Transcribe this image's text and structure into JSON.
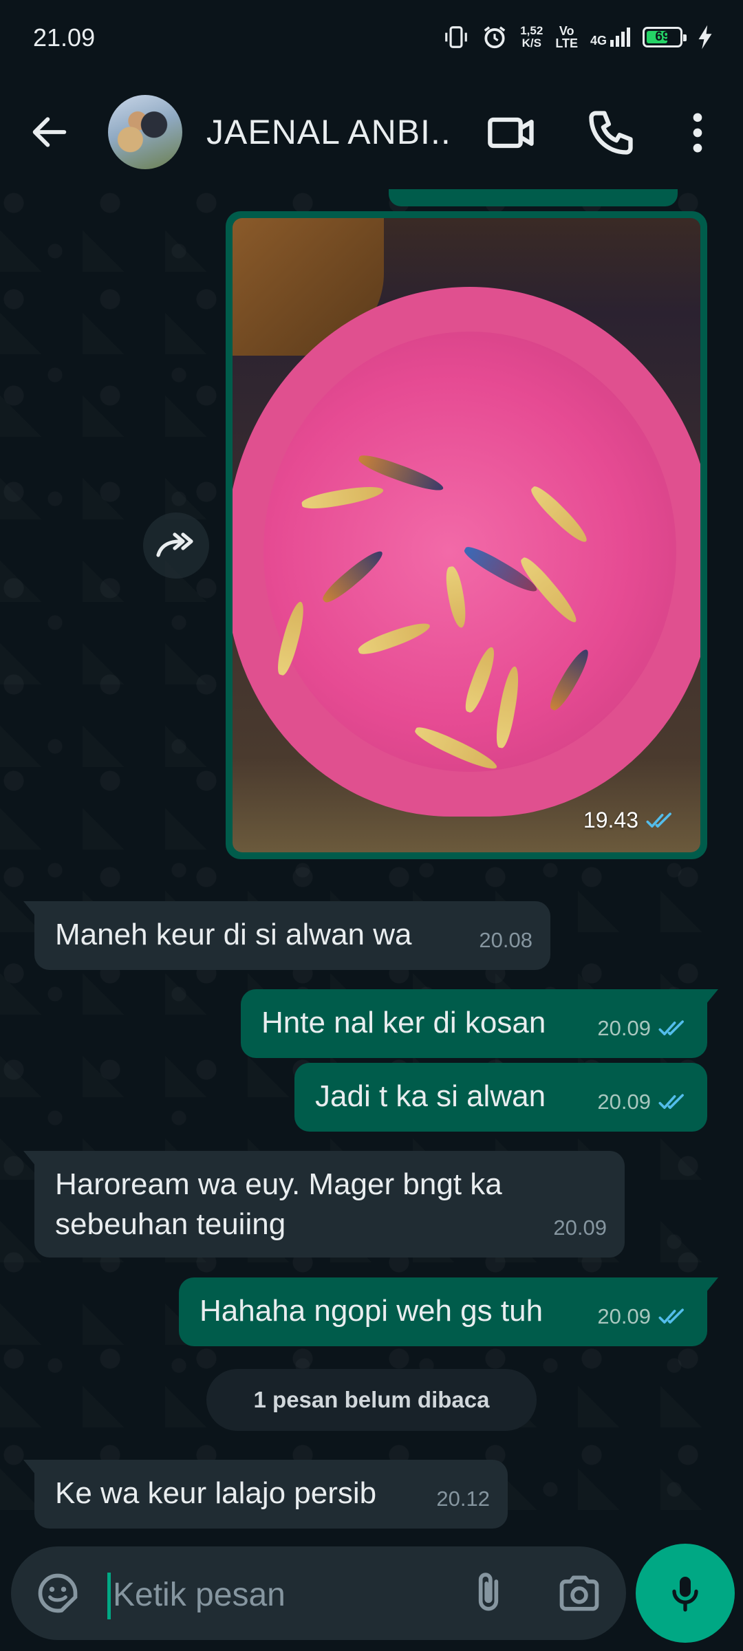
{
  "status_bar": {
    "time": "21.09",
    "net_speed_value": "1,52",
    "net_speed_unit": "K/S",
    "volte_top": "Vo",
    "volte_bottom": "LTE",
    "network": "4G",
    "battery_percent": "69",
    "battery_level": 0.69,
    "icons": [
      "vibrate-icon",
      "alarm-icon",
      "signal-icon",
      "battery-icon",
      "charging-icon"
    ]
  },
  "header": {
    "contact_name": "JAENAL ANBI...",
    "icons": [
      "back-arrow-icon",
      "video-call-icon",
      "phone-icon",
      "more-vert-icon"
    ]
  },
  "messages": [
    {
      "type": "image",
      "direction": "out",
      "time": "19.43",
      "status": "read"
    },
    {
      "type": "text",
      "direction": "in",
      "text": "Maneh keur di si alwan wa",
      "time": "20.08"
    },
    {
      "type": "text",
      "direction": "out",
      "text": "Hnte nal ker di kosan",
      "time": "20.09",
      "status": "read"
    },
    {
      "type": "text",
      "direction": "out",
      "text": "Jadi t ka si alwan",
      "time": "20.09",
      "status": "read"
    },
    {
      "type": "text",
      "direction": "in",
      "text": "Haroream wa euy. Mager bngt ka sebeuhan teuiing",
      "time": "20.09"
    },
    {
      "type": "text",
      "direction": "out",
      "text": "Hahaha ngopi weh gs tuh",
      "time": "20.09",
      "status": "read"
    },
    {
      "type": "text",
      "direction": "in",
      "text": "Ke wa keur lalajo persib",
      "time": "20.12"
    }
  ],
  "unread_banner": "1 pesan belum dibaca",
  "composer": {
    "placeholder": "Ketik pesan",
    "value": ""
  },
  "colors": {
    "background": "#0b141a",
    "incoming_bubble": "#202c33",
    "outgoing_bubble": "#005c4b",
    "accent": "#00a884",
    "read_ticks": "#53bdeb"
  }
}
